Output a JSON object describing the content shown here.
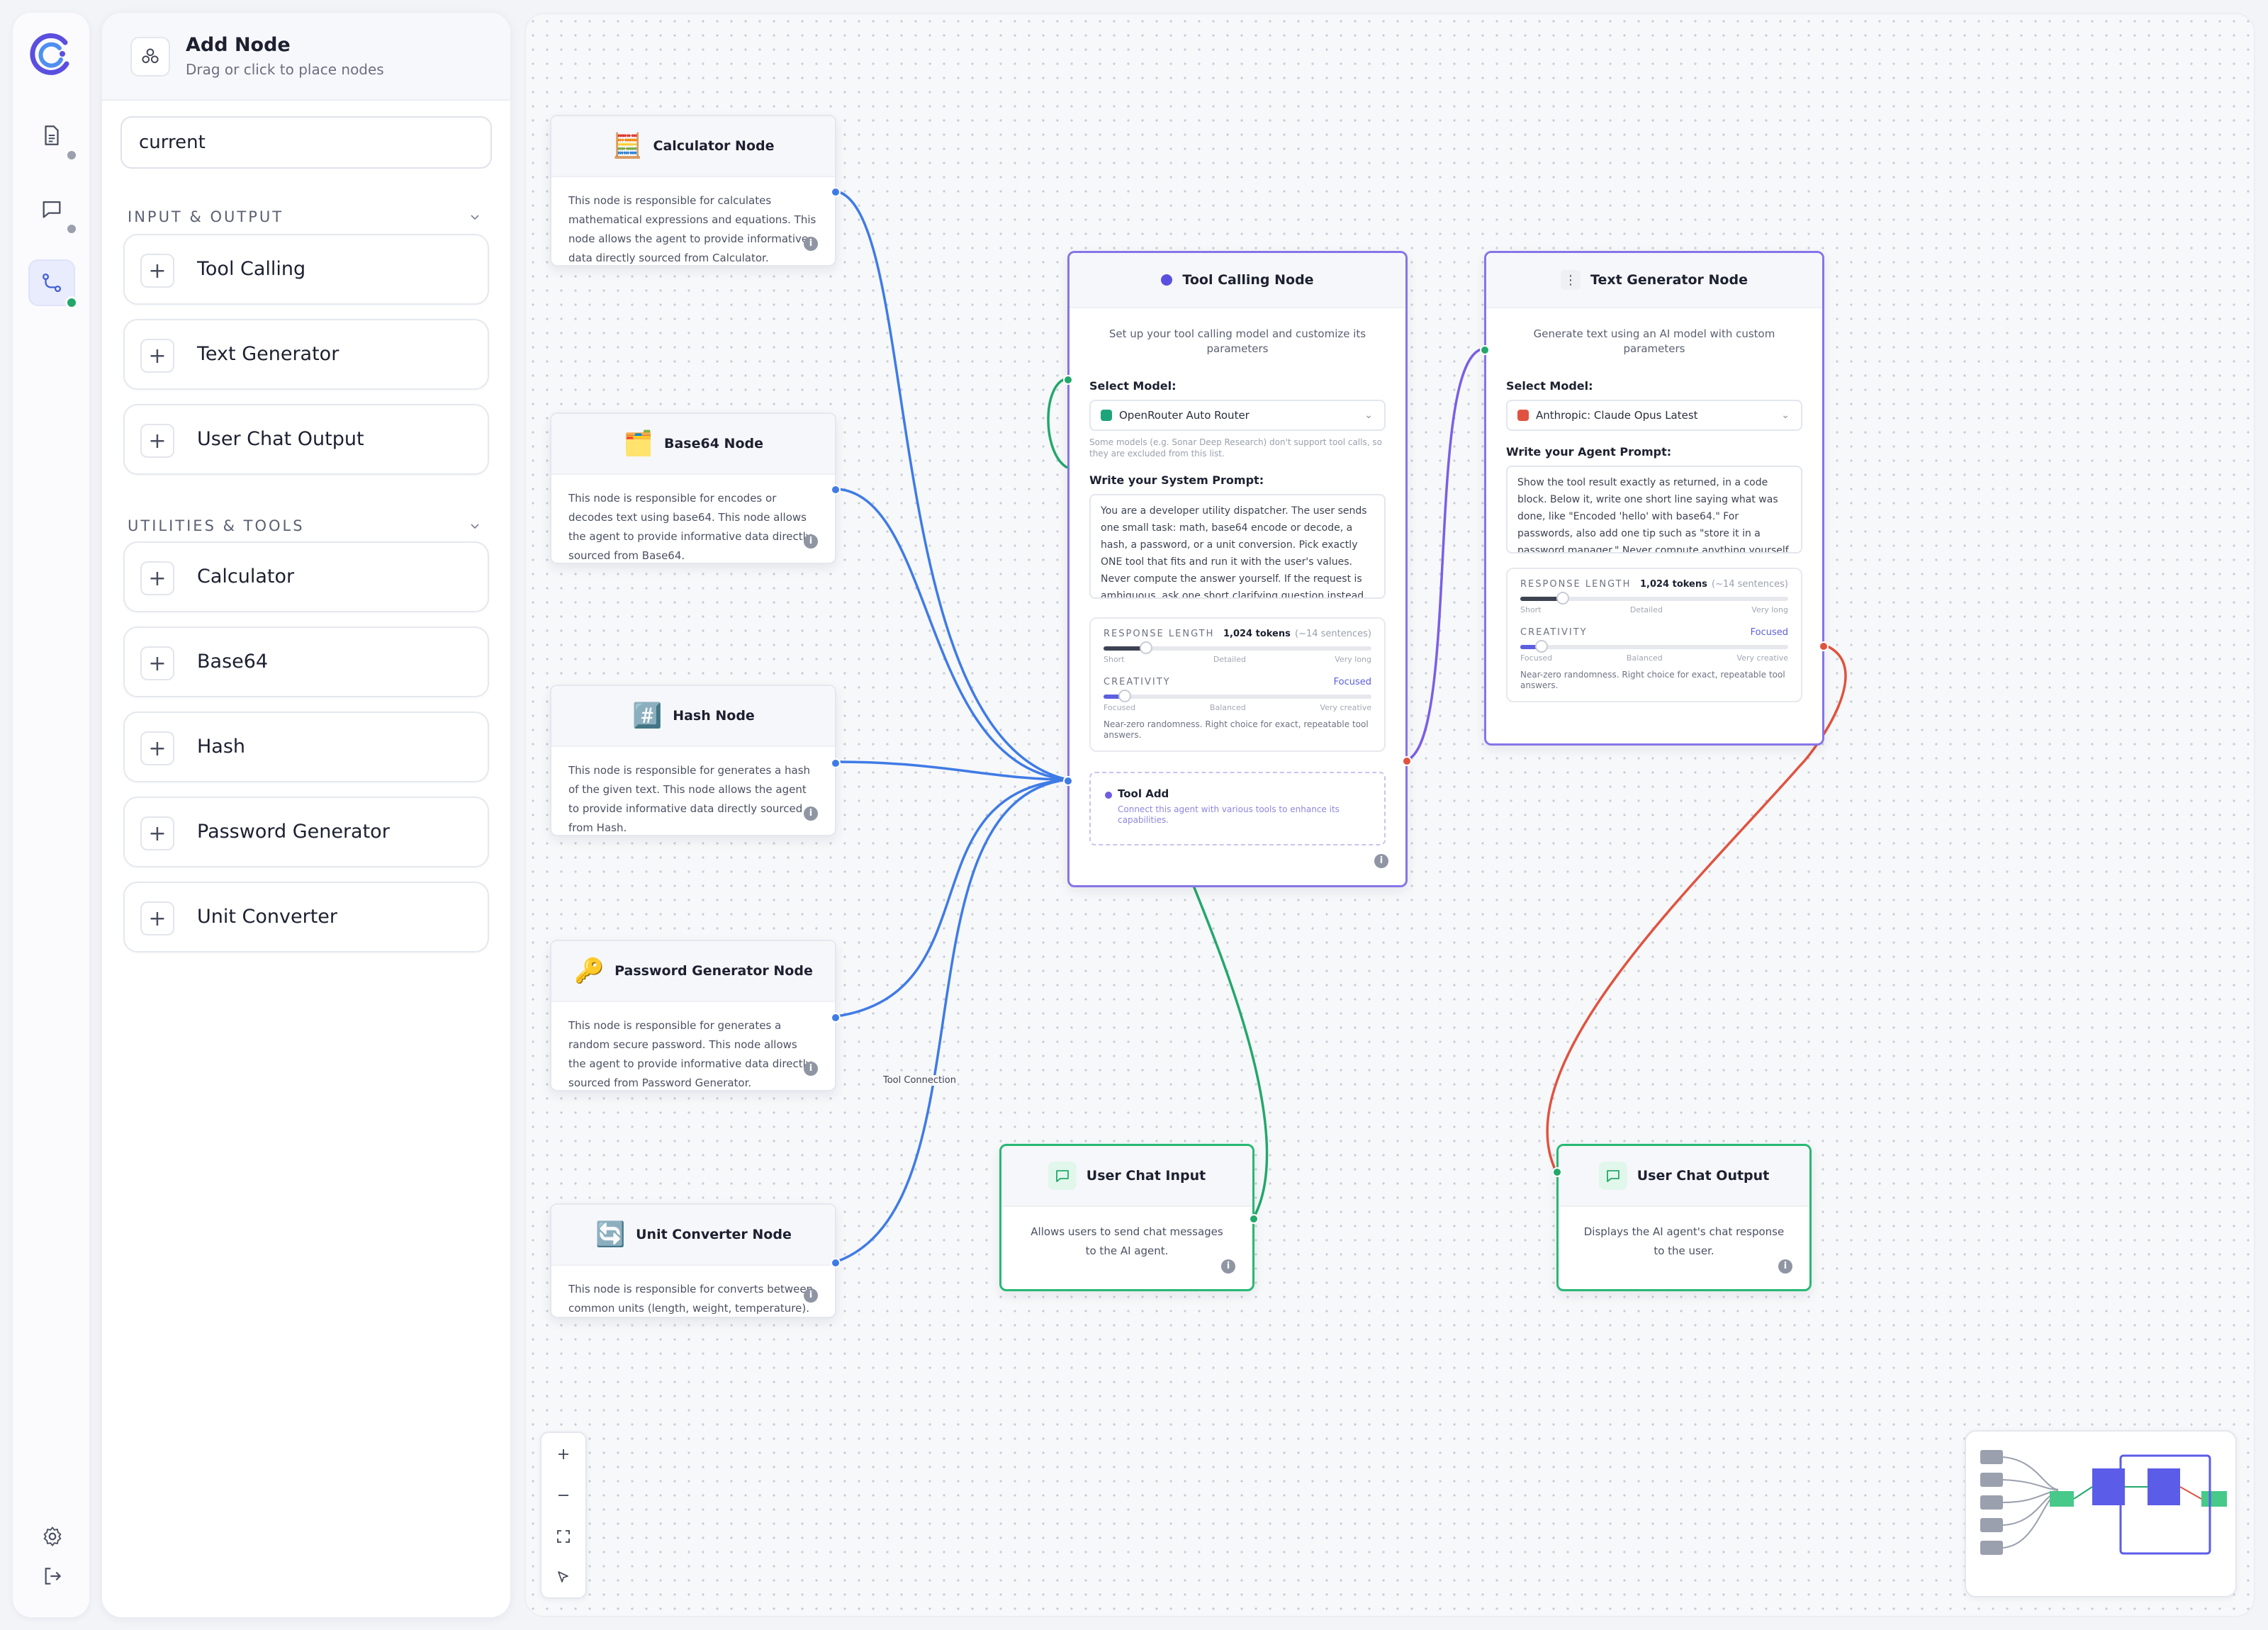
{
  "sidebar": {
    "logo": "app-logo",
    "items": [
      {
        "name": "document-icon",
        "status": "gray"
      },
      {
        "name": "chat-icon",
        "status": "gray"
      },
      {
        "name": "workflow-icon",
        "status": "green",
        "active": true
      }
    ],
    "footer": [
      "settings-icon",
      "logout-icon"
    ]
  },
  "panel": {
    "title": "Add Node",
    "subtitle": "Drag or click to place nodes",
    "search_value": "current",
    "search_placeholder": "",
    "sections": [
      {
        "heading": "INPUT & OUTPUT",
        "items": [
          "Tool Calling",
          "Text Generator",
          "User Chat Output"
        ]
      },
      {
        "heading": "UTILITIES & TOOLS",
        "items": [
          "Calculator",
          "Base64",
          "Hash",
          "Password Generator",
          "Unit Converter"
        ]
      }
    ]
  },
  "canvas": {
    "tool_nodes": [
      {
        "title": "Calculator Node",
        "icon": "🧮",
        "desc": "This node is responsible for calculates mathematical expressions and equations. This node allows the agent to provide informative data directly sourced from Calculator."
      },
      {
        "title": "Base64 Node",
        "icon": "🗂️",
        "desc": "This node is responsible for encodes or decodes text using base64. This node allows the agent to provide informative data directly sourced from Base64."
      },
      {
        "title": "Hash Node",
        "icon": "#️⃣",
        "desc": "This node is responsible for generates a hash of the given text. This node allows the agent to provide informative data directly sourced from Hash."
      },
      {
        "title": "Password Generator Node",
        "icon": "🔑",
        "desc": "This node is responsible for generates a random secure password. This node allows the agent to provide informative data directly sourced from Password Generator."
      },
      {
        "title": "Unit Converter Node",
        "icon": "🔄",
        "desc": "This node is responsible for converts between common units (length, weight, temperature)."
      }
    ],
    "tool_calling": {
      "title": "Tool Calling Node",
      "desc": "Set up your tool calling model and customize its parameters",
      "model_label": "Select Model:",
      "model_value": "OpenRouter Auto Router",
      "model_color": "#1fa37a",
      "model_note": "Some models (e.g. Sonar Deep Research) don't support tool calls, so they are excluded from this list.",
      "prompt_label": "Write your System Prompt:",
      "prompt_text": "You are a developer utility dispatcher. The user sends one small task: math, base64 encode or decode, a hash, a password, or a unit conversion. Pick exactly ONE tool that fits and run it with the user's values. Never compute the answer yourself. If the request is ambiguous, ask one short clarifying question instead of running a tool.",
      "response_label": "RESPONSE LENGTH",
      "response_value": "1,024 tokens",
      "response_hint": "(~14 sentences)",
      "response_level": 0.16,
      "response_ticks": [
        "Short",
        "Detailed",
        "Very long"
      ],
      "creativity_label": "CREATIVITY",
      "creativity_value": "Focused",
      "creativity_level": 0.08,
      "creativity_ticks": [
        "Focused",
        "Balanced",
        "Very creative"
      ],
      "creativity_desc": "Near-zero randomness. Right choice for exact, repeatable tool answers.",
      "tool_add_title": "Tool Add",
      "tool_add_desc": "Connect this agent with various tools to enhance its capabilities."
    },
    "text_generator": {
      "title": "Text Generator Node",
      "desc": "Generate text using an AI model with custom parameters",
      "model_label": "Select Model:",
      "model_value": "Anthropic: Claude Opus Latest",
      "model_color": "#e0533f",
      "prompt_label": "Write your Agent Prompt:",
      "prompt_text": "Show the tool result exactly as returned, in a code block. Below it, write one short line saying what was done, like \"Encoded 'hello' with base64.\" For passwords, also add one tip such as \"store it in a password manager.\" Never compute anything yourself — the tool result is the",
      "response_label": "RESPONSE LENGTH",
      "response_value": "1,024 tokens",
      "response_hint": "(~14 sentences)",
      "response_level": 0.16,
      "response_ticks": [
        "Short",
        "Detailed",
        "Very long"
      ],
      "creativity_label": "CREATIVITY",
      "creativity_value": "Focused",
      "creativity_level": 0.08,
      "creativity_ticks": [
        "Focused",
        "Balanced",
        "Very creative"
      ],
      "creativity_desc": "Near-zero randomness. Right choice for exact, repeatable tool answers."
    },
    "user_chat_input": {
      "title": "User Chat Input",
      "desc": "Allows users to send chat messages to the AI agent."
    },
    "user_chat_output": {
      "title": "User Chat Output",
      "desc": "Displays the AI agent's chat response to the user."
    },
    "edge_label": "Tool Connection",
    "colors": {
      "tool_edge": "#3f7be6",
      "purple_edge": "#7b5ee8",
      "green_edge": "#22a86b",
      "red_edge": "#e0533f",
      "node_accent": "#6d5ce6"
    },
    "controls": [
      "zoom-in-icon",
      "zoom-out-icon",
      "fit-view-icon",
      "lock-icon"
    ]
  }
}
